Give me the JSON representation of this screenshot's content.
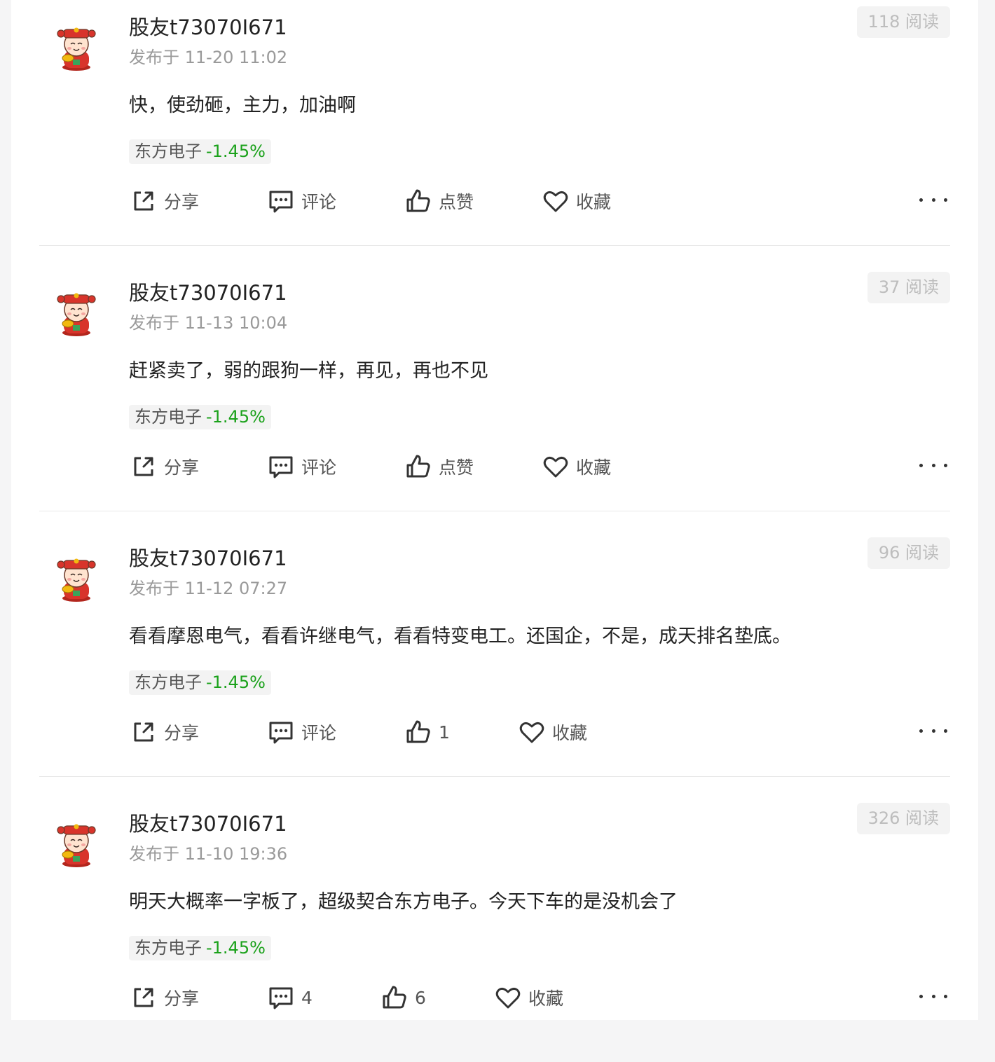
{
  "posts": [
    {
      "author": "股友t73070I671",
      "time": "发布于 11-20 11:02",
      "reads": "118 阅读",
      "content": "快，使劲砸，主力，加油啊",
      "stock": {
        "name": "东方电子",
        "change": "-1.45%"
      },
      "actions": {
        "share": "分享",
        "comment": "评论",
        "like": "点赞",
        "favorite": "收藏"
      }
    },
    {
      "author": "股友t73070I671",
      "time": "发布于 11-13 10:04",
      "reads": "37 阅读",
      "content": "赶紧卖了，弱的跟狗一样，再见，再也不见",
      "stock": {
        "name": "东方电子",
        "change": "-1.45%"
      },
      "actions": {
        "share": "分享",
        "comment": "评论",
        "like": "点赞",
        "favorite": "收藏"
      }
    },
    {
      "author": "股友t73070I671",
      "time": "发布于 11-12 07:27",
      "reads": "96 阅读",
      "content": "看看摩恩电气，看看许继电气，看看特变电工。还国企，不是，成天排名垫底。",
      "stock": {
        "name": "东方电子",
        "change": "-1.45%"
      },
      "actions": {
        "share": "分享",
        "comment": "评论",
        "like": "1",
        "favorite": "收藏"
      }
    },
    {
      "author": "股友t73070I671",
      "time": "发布于 11-10 19:36",
      "reads": "326 阅读",
      "content": "明天大概率一字板了，超级契合东方电子。今天下车的是没机会了",
      "stock": {
        "name": "东方电子",
        "change": "-1.45%"
      },
      "actions": {
        "share": "分享",
        "comment": "4",
        "like": "6",
        "favorite": "收藏"
      }
    }
  ],
  "colors": {
    "stock_down": "#1aa11a",
    "avatar_red": "#d8342b",
    "avatar_gold": "#f2b90f"
  }
}
